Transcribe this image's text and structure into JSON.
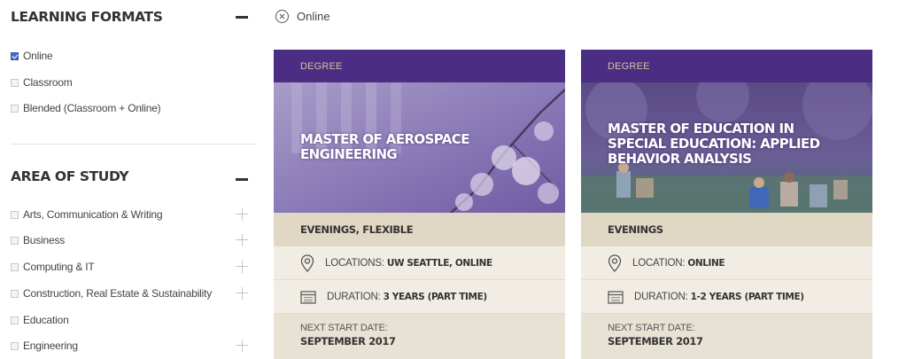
{
  "sidebar": {
    "learning_formats": {
      "title": "LEARNING FORMATS",
      "options": [
        {
          "label": "Online",
          "checked": true
        },
        {
          "label": "Classroom",
          "checked": false
        },
        {
          "label": "Blended (Classroom + Online)",
          "checked": false
        }
      ]
    },
    "area_of_study": {
      "title": "AREA OF STUDY",
      "options": [
        {
          "label": "Arts, Communication & Writing",
          "expandable": true
        },
        {
          "label": "Business",
          "expandable": true
        },
        {
          "label": "Computing & IT",
          "expandable": true
        },
        {
          "label": "Construction, Real Estate & Sustainability",
          "expandable": true
        },
        {
          "label": "Education",
          "expandable": false
        },
        {
          "label": "Engineering",
          "expandable": true
        }
      ]
    }
  },
  "active_filter": {
    "label": "Online",
    "icon": "close-circle-icon"
  },
  "cards": [
    {
      "type": "DEGREE",
      "title_lines": [
        "MASTER OF AEROSPACE",
        "ENGINEERING"
      ],
      "schedule": "EVENINGS, FLEXIBLE",
      "location_label": "LOCATIONS:",
      "location_value": "UW SEATTLE, ONLINE",
      "duration_label": "DURATION:",
      "duration_value": "3 YEARS (PART TIME)",
      "start_label": "NEXT START DATE:",
      "start_value": "SEPTEMBER 2017"
    },
    {
      "type": "DEGREE",
      "title_lines": [
        "MASTER OF EDUCATION IN",
        "SPECIAL EDUCATION: APPLIED",
        "BEHAVIOR ANALYSIS"
      ],
      "schedule": "EVENINGS",
      "location_label": "LOCATION:",
      "location_value": "ONLINE",
      "duration_label": "DURATION:",
      "duration_value": "1-2 YEARS (PART TIME)",
      "start_label": "NEXT START DATE:",
      "start_value": "SEPTEMBER 2017"
    }
  ],
  "colors": {
    "brand_purple": "#4b2e83",
    "gold": "#d4c29a",
    "tan": "#e0d7c4",
    "checkbox_blue": "#4a69c6"
  }
}
